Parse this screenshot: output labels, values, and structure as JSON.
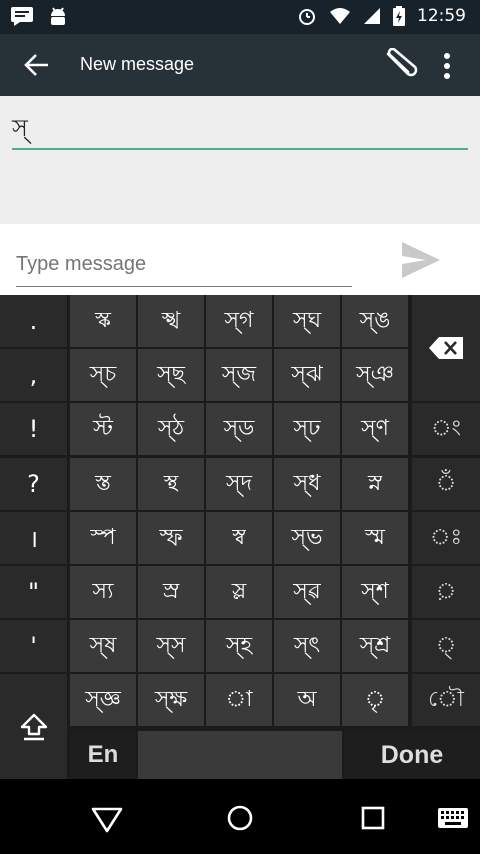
{
  "status": {
    "time": "12:59"
  },
  "appbar": {
    "title": "New message"
  },
  "recipient": {
    "value": "স্"
  },
  "compose": {
    "placeholder": "Type message"
  },
  "keyboard": {
    "punct": [
      ".",
      ",",
      "!",
      "?",
      "।",
      "\"",
      "'"
    ],
    "rows": [
      [
        "স্ক",
        "স্খ",
        "স্গ",
        "স্ঘ",
        "স্ঙ"
      ],
      [
        "স্চ",
        "স্ছ",
        "স্জ",
        "স্ঝ",
        "স্ঞ"
      ],
      [
        "স্ট",
        "স্ঠ",
        "স্ড",
        "স্ঢ",
        "স্ণ"
      ],
      [
        "স্ত",
        "স্থ",
        "স্দ",
        "স্ধ",
        "স্ন"
      ],
      [
        "স্প",
        "স্ফ",
        "স্ব",
        "স্ভ",
        "স্ম"
      ],
      [
        "স্য",
        "স্র",
        "স্ল",
        "স্ৱ",
        "স্শ"
      ],
      [
        "স্ষ",
        "স্স",
        "স্হ",
        "স্ৎ",
        "স্শ্র"
      ],
      [
        "স্জ্ঞ",
        "স্ক্ষ",
        "া",
        "অ",
        "ৃ"
      ]
    ],
    "signs": [
      "ং",
      "ঁ",
      "ঃ",
      "়",
      "্",
      "ৌ"
    ],
    "en_label": "En",
    "done_label": "Done"
  },
  "colors": {
    "accent": "#4caf8f",
    "appbar": "#263238",
    "keyboard": "#1b1b1b"
  }
}
